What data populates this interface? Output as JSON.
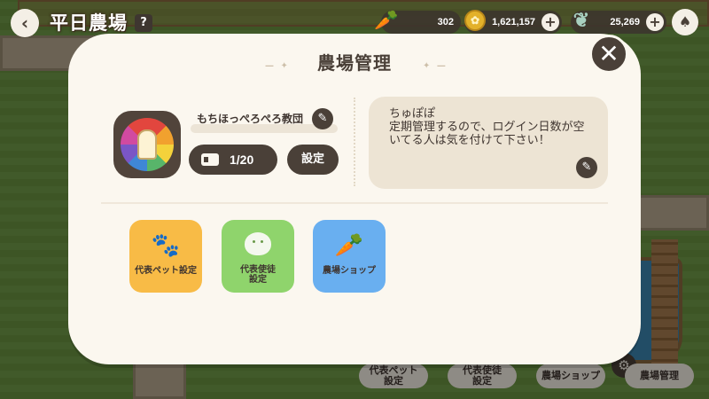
{
  "header": {
    "back_label": "‹",
    "title": "平日農場",
    "help_label": "?"
  },
  "resources": [
    {
      "icon": "carrot-icon",
      "value": "302"
    },
    {
      "icon": "coin-icon",
      "value": "1,621,157"
    },
    {
      "icon": "leaf-gem-icon",
      "value": "25,269"
    }
  ],
  "modal": {
    "title": "農場管理",
    "farm_name": "もちほっぺろぺろ教団",
    "member_count": "1/20",
    "settings_label": "設定",
    "notice": "ちゅぽぽ\n定期管理するので、ログイン日数が空いてる人は気を付けて下さい！",
    "tiles": [
      {
        "label": "代表ペット設定",
        "color": "#f8bb46"
      },
      {
        "label": "代表使徒\n設定",
        "color": "#8fd46c"
      },
      {
        "label": "農場ショップ",
        "color": "#69aff0"
      }
    ]
  },
  "bottom_bar": [
    {
      "label": "代表ペット\n設定"
    },
    {
      "label": "代表使徒\n設定"
    },
    {
      "label": "農場ショップ"
    },
    {
      "label": "農場管理"
    }
  ],
  "colors": {
    "panel": "#fbf7ef",
    "dark_button": "#4a4038",
    "notice_bg": "#ede4d4"
  }
}
